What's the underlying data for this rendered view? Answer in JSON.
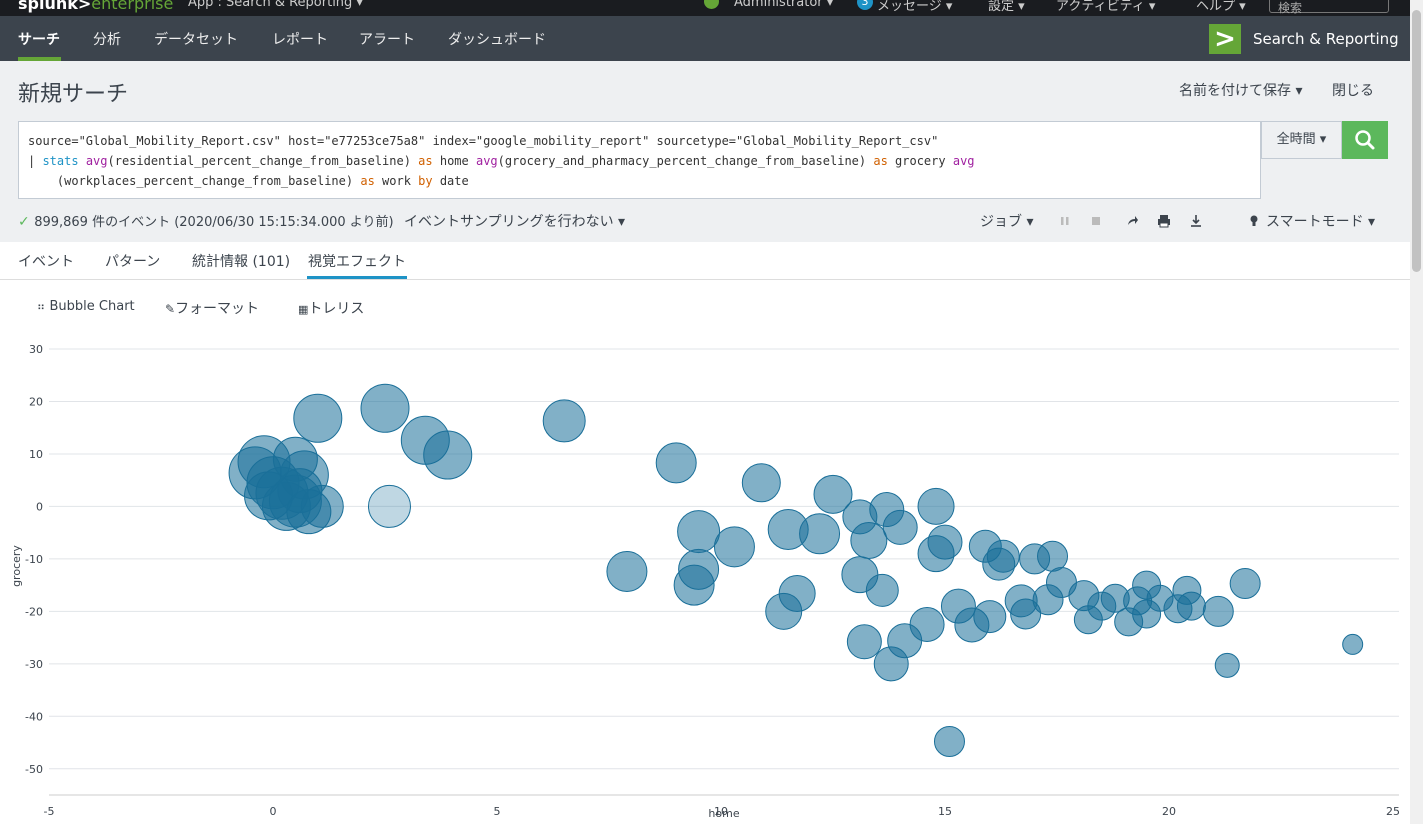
{
  "topbar": {
    "logo_main": "splunk>",
    "logo_sub": "enterprise",
    "app_label": "App : Search & Reporting ▾",
    "user": "Administrator ▾",
    "messages_count": "3",
    "messages": "メッセージ ▾",
    "settings": "設定 ▾",
    "activity": "アクティビティ ▾",
    "help": "ヘルプ ▾",
    "search_placeholder": "検索"
  },
  "appbar": {
    "nav": [
      "サーチ",
      "分析",
      "データセット",
      "レポート",
      "アラート",
      "ダッシュボード"
    ],
    "app_name": "Search & Reporting"
  },
  "header": {
    "title": "新規サーチ",
    "save_as": "名前を付けて保存 ▾",
    "close": "閉じる"
  },
  "query": {
    "line1": "source=\"Global_Mobility_Report.csv\" host=\"e77253ce75a8\" index=\"google_mobility_report\" sourcetype=\"Global_Mobility_Report_csv\"",
    "pipe": "| ",
    "stats": "stats",
    "avg1": "avg",
    "arg1": "(residential_percent_change_from_baseline) ",
    "as1": "as",
    "mid1": " home ",
    "avg2": "avg",
    "arg2": "(grocery_and_pharmacy_percent_change_from_baseline) ",
    "as2": "as",
    "mid2": " grocery ",
    "avg3": "avg",
    "line3_indent": "    (workplaces_percent_change_from_baseline) ",
    "as3": "as",
    "mid3": " work ",
    "by": "by",
    "end3": " date"
  },
  "time_picker": "全時間 ▾",
  "status": {
    "events": "899,869 件のイベント (2020/06/30 15:15:34.000 より前)",
    "sampling": "イベントサンプリングを行わない ▾",
    "job": "ジョブ ▾",
    "mode": "スマートモード ▾"
  },
  "tabs": [
    "イベント",
    "パターン",
    "統計情報 (101)",
    "視覚エフェクト"
  ],
  "viz": {
    "type": "Bubble Chart",
    "format": "フォーマット",
    "trellis": "トレリス"
  },
  "colors": {
    "accent": "#65a637",
    "bubble": "#1a6f99",
    "link": "#1e93c6"
  },
  "chart_data": {
    "type": "scatter",
    "xlabel": "home",
    "ylabel": "grocery",
    "xlim": [
      -5,
      25
    ],
    "ylim": [
      -55,
      30
    ],
    "xticks": [
      "-5",
      "0",
      "5",
      "10",
      "15",
      "20",
      "25"
    ],
    "yticks": [
      "30",
      "20",
      "10",
      "0",
      "-10",
      "-20",
      "-30",
      "-40",
      "-50"
    ],
    "points": [
      {
        "x": 1.0,
        "y": 16.8,
        "r": 24
      },
      {
        "x": 2.5,
        "y": 18.7,
        "r": 24
      },
      {
        "x": 3.4,
        "y": 12.6,
        "r": 24
      },
      {
        "x": 3.9,
        "y": 9.8,
        "r": 24
      },
      {
        "x": 2.6,
        "y": 0.0,
        "r": 21,
        "light": true
      },
      {
        "x": -0.4,
        "y": 6.4,
        "r": 26
      },
      {
        "x": -0.2,
        "y": 8.5,
        "r": 26
      },
      {
        "x": 0.0,
        "y": 4.5,
        "r": 26
      },
      {
        "x": 0.2,
        "y": 2.5,
        "r": 26
      },
      {
        "x": 0.5,
        "y": 1.0,
        "r": 26
      },
      {
        "x": 0.5,
        "y": 9.0,
        "r": 22
      },
      {
        "x": 0.7,
        "y": 6.0,
        "r": 24
      },
      {
        "x": 0.3,
        "y": 0.0,
        "r": 24
      },
      {
        "x": 0.8,
        "y": -1.0,
        "r": 22
      },
      {
        "x": 1.1,
        "y": 0.0,
        "r": 21
      },
      {
        "x": -0.1,
        "y": 2.0,
        "r": 24
      },
      {
        "x": 0.6,
        "y": 3.0,
        "r": 22
      },
      {
        "x": 6.5,
        "y": 16.3,
        "r": 21
      },
      {
        "x": 9.0,
        "y": 8.3,
        "r": 20
      },
      {
        "x": 7.9,
        "y": -12.4,
        "r": 20
      },
      {
        "x": 9.5,
        "y": -4.8,
        "r": 21
      },
      {
        "x": 9.5,
        "y": -12.0,
        "r": 20
      },
      {
        "x": 9.4,
        "y": -15.0,
        "r": 20
      },
      {
        "x": 10.3,
        "y": -7.7,
        "r": 20
      },
      {
        "x": 10.9,
        "y": 4.5,
        "r": 19
      },
      {
        "x": 11.5,
        "y": -4.4,
        "r": 20
      },
      {
        "x": 11.4,
        "y": -20.0,
        "r": 18
      },
      {
        "x": 11.7,
        "y": -16.6,
        "r": 18
      },
      {
        "x": 12.2,
        "y": -5.2,
        "r": 20
      },
      {
        "x": 12.5,
        "y": 2.3,
        "r": 19
      },
      {
        "x": 13.1,
        "y": -2.0,
        "r": 17
      },
      {
        "x": 13.7,
        "y": -0.6,
        "r": 17
      },
      {
        "x": 13.3,
        "y": -6.5,
        "r": 18
      },
      {
        "x": 13.1,
        "y": -13.0,
        "r": 18
      },
      {
        "x": 13.6,
        "y": -16.0,
        "r": 16
      },
      {
        "x": 13.2,
        "y": -25.8,
        "r": 17
      },
      {
        "x": 13.8,
        "y": -30.0,
        "r": 17
      },
      {
        "x": 14.1,
        "y": -25.6,
        "r": 17
      },
      {
        "x": 14.0,
        "y": -4.0,
        "r": 17
      },
      {
        "x": 14.6,
        "y": -22.5,
        "r": 17
      },
      {
        "x": 14.8,
        "y": 0.0,
        "r": 18
      },
      {
        "x": 14.8,
        "y": -9.0,
        "r": 18
      },
      {
        "x": 15.0,
        "y": -6.8,
        "r": 17
      },
      {
        "x": 15.3,
        "y": -19.0,
        "r": 17
      },
      {
        "x": 15.6,
        "y": -22.6,
        "r": 17
      },
      {
        "x": 15.9,
        "y": -7.6,
        "r": 16
      },
      {
        "x": 16.0,
        "y": -21.0,
        "r": 16
      },
      {
        "x": 16.2,
        "y": -11.0,
        "r": 16
      },
      {
        "x": 16.3,
        "y": -9.5,
        "r": 16
      },
      {
        "x": 15.1,
        "y": -44.8,
        "r": 15
      },
      {
        "x": 16.7,
        "y": -18.0,
        "r": 16
      },
      {
        "x": 16.8,
        "y": -20.5,
        "r": 15
      },
      {
        "x": 17.0,
        "y": -10.0,
        "r": 15
      },
      {
        "x": 17.4,
        "y": -9.5,
        "r": 15
      },
      {
        "x": 17.6,
        "y": -14.5,
        "r": 15
      },
      {
        "x": 17.3,
        "y": -17.8,
        "r": 15
      },
      {
        "x": 18.1,
        "y": -17.0,
        "r": 15
      },
      {
        "x": 18.2,
        "y": -21.6,
        "r": 14
      },
      {
        "x": 18.5,
        "y": -19.0,
        "r": 14
      },
      {
        "x": 18.8,
        "y": -17.5,
        "r": 14
      },
      {
        "x": 19.1,
        "y": -22.0,
        "r": 14
      },
      {
        "x": 19.3,
        "y": -18.0,
        "r": 14
      },
      {
        "x": 19.5,
        "y": -15.0,
        "r": 14
      },
      {
        "x": 19.5,
        "y": -20.5,
        "r": 14
      },
      {
        "x": 19.8,
        "y": -17.5,
        "r": 13
      },
      {
        "x": 20.2,
        "y": -19.5,
        "r": 14
      },
      {
        "x": 20.4,
        "y": -16.0,
        "r": 14
      },
      {
        "x": 20.5,
        "y": -19.0,
        "r": 14
      },
      {
        "x": 21.1,
        "y": -20.0,
        "r": 15
      },
      {
        "x": 21.7,
        "y": -14.7,
        "r": 15
      },
      {
        "x": 21.3,
        "y": -30.3,
        "r": 12
      },
      {
        "x": 24.1,
        "y": -26.3,
        "r": 10
      }
    ]
  }
}
